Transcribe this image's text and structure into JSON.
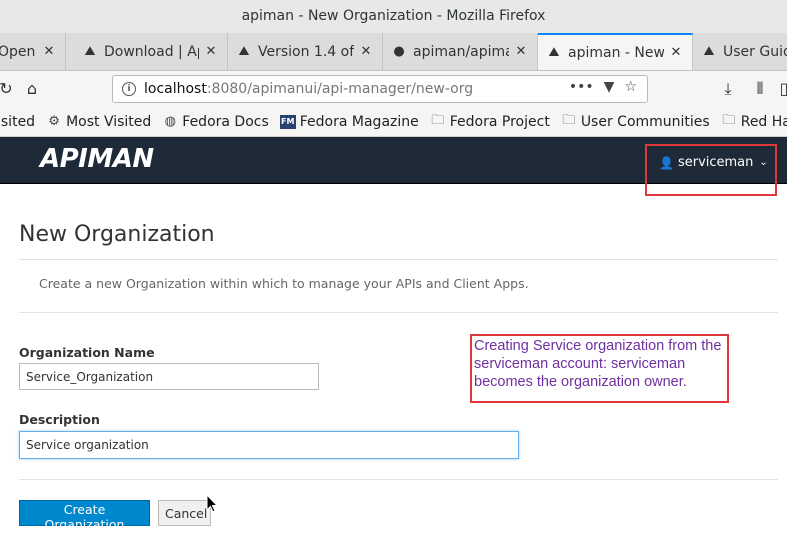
{
  "window": {
    "title": "apiman - New Organization - Mozilla Firefox"
  },
  "tabs": [
    {
      "label": "Open",
      "icon": "tab-icon",
      "active": false
    },
    {
      "label": "Download | Ap",
      "icon": "apiman-favicon",
      "active": false
    },
    {
      "label": "Version 1.4 of",
      "icon": "apiman-favicon",
      "active": false
    },
    {
      "label": "apiman/apiman",
      "icon": "github-icon",
      "active": false
    },
    {
      "label": "apiman - New",
      "icon": "apiman-favicon",
      "active": true
    },
    {
      "label": "User Guid",
      "icon": "apiman-favicon",
      "active": false
    }
  ],
  "url": {
    "host": "localhost",
    "path": ":8080/apimanui/api-manager/new-org"
  },
  "bookmarks": [
    {
      "label": "isited",
      "icon": ""
    },
    {
      "label": "Most Visited",
      "icon": "gear-icon"
    },
    {
      "label": "Fedora Docs",
      "icon": "globe-icon"
    },
    {
      "label": "Fedora Magazine",
      "icon": "fm-icon"
    },
    {
      "label": "Fedora Project",
      "icon": "folder-icon"
    },
    {
      "label": "User Communities",
      "icon": "folder-icon"
    },
    {
      "label": "Red Hat",
      "icon": "folder-icon"
    }
  ],
  "app": {
    "logo": "APIMAN",
    "user": "serviceman"
  },
  "page": {
    "title": "New Organization",
    "description": "Create a new Organization within which to manage your APIs and Client Apps."
  },
  "form": {
    "org_name_label": "Organization Name",
    "org_name_value": "Service_Organization",
    "description_label": "Description",
    "description_value": "Service organization",
    "create_label": "Create Organization",
    "cancel_label": "Cancel"
  },
  "annotation": {
    "text": "Creating Service organization from the serviceman account: serviceman becomes the organization owner."
  },
  "colors": {
    "accent": "#0088ce",
    "header_bg": "#1f2a38",
    "highlight": "#e0383a",
    "annotation": "#7030a0"
  }
}
